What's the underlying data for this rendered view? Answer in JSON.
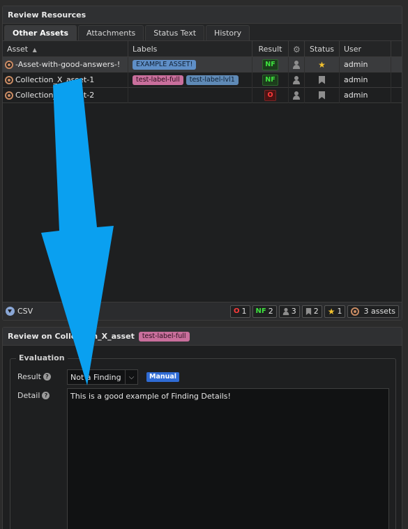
{
  "review_resources": {
    "title": "Review Resources",
    "tabs": [
      {
        "label": "Other Assets"
      },
      {
        "label": "Attachments"
      },
      {
        "label": "Status Text"
      },
      {
        "label": "History"
      }
    ],
    "columns": {
      "asset": "Asset",
      "labels": "Labels",
      "result": "Result",
      "status": "Status",
      "user": "User"
    },
    "rows": [
      {
        "asset": "-Asset-with-good-answers-!",
        "labels": [
          "EXAMPLE ASSET!"
        ],
        "result": "NF",
        "status": "star",
        "user": "admin"
      },
      {
        "asset": "Collection_X_asset-1",
        "labels": [
          "test-label-full",
          "test-label-lvl1"
        ],
        "result": "NF",
        "status": "bookmark",
        "user": "admin"
      },
      {
        "asset": "Collection_X_asset-2",
        "labels": [],
        "result": "O",
        "status": "bookmark",
        "user": "admin"
      }
    ],
    "footer": {
      "csv_label": "CSV",
      "stats": {
        "o_label": "O",
        "o_count": "1",
        "nf_label": "NF",
        "nf_count": "2",
        "person_count": "3",
        "bookmark_count": "2",
        "star_count": "1",
        "assets_label": "3 assets"
      }
    }
  },
  "review": {
    "title": "Review on Collection_X_asset",
    "label": "test-label-full",
    "evaluation_legend": "Evaluation",
    "result_label": "Result",
    "result_value": "Not a Finding",
    "manual_badge": "Manual",
    "detail_label": "Detail",
    "detail_text": "This is a good example of Finding Details!"
  },
  "colors": {
    "arrow": "#0aa0f0",
    "nf": "#3ee33e",
    "open": "#ff3b3b",
    "manual": "#2f6bd4"
  }
}
